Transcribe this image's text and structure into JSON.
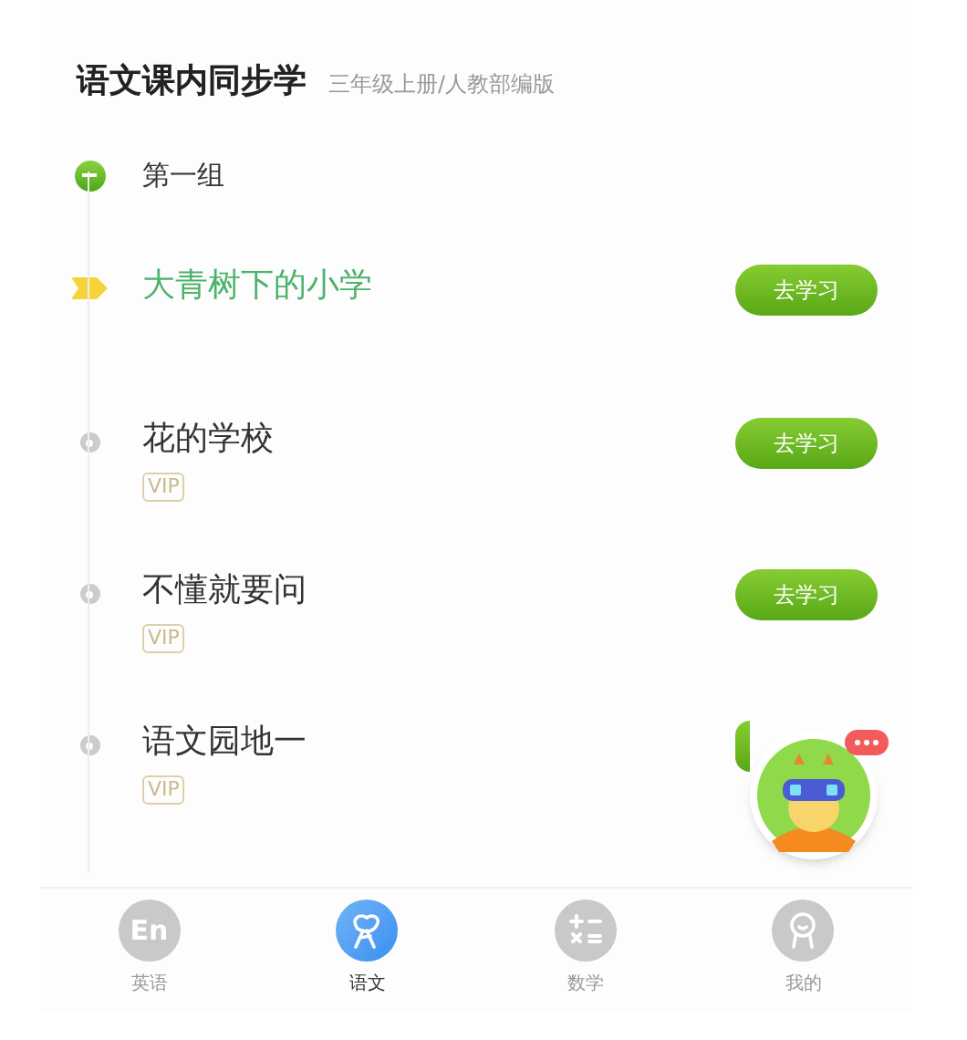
{
  "header": {
    "title": "语文课内同步学",
    "subtitle": "三年级上册/人教部编版"
  },
  "group": {
    "label": "第一组",
    "expanded": true
  },
  "lessons": [
    {
      "title": "大青树下的小学",
      "current": true,
      "vip": false,
      "action": {
        "label": "去学习"
      }
    },
    {
      "title": "花的学校",
      "current": false,
      "vip": true,
      "vip_label": "VIP",
      "action": {
        "label": "去学习"
      }
    },
    {
      "title": "不懂就要问",
      "current": false,
      "vip": true,
      "vip_label": "VIP",
      "action": {
        "label": "去学习"
      }
    },
    {
      "title": "语文园地一",
      "current": false,
      "vip": true,
      "vip_label": "VIP",
      "action": {
        "covered": true
      }
    }
  ],
  "assistant": {
    "has_message": true
  },
  "nav": [
    {
      "label": "英语",
      "kind": "english",
      "icon_text": "En",
      "selected": false
    },
    {
      "label": "语文",
      "kind": "chinese",
      "selected": true
    },
    {
      "label": "数学",
      "kind": "math",
      "selected": false
    },
    {
      "label": "我的",
      "kind": "profile",
      "selected": false
    }
  ]
}
